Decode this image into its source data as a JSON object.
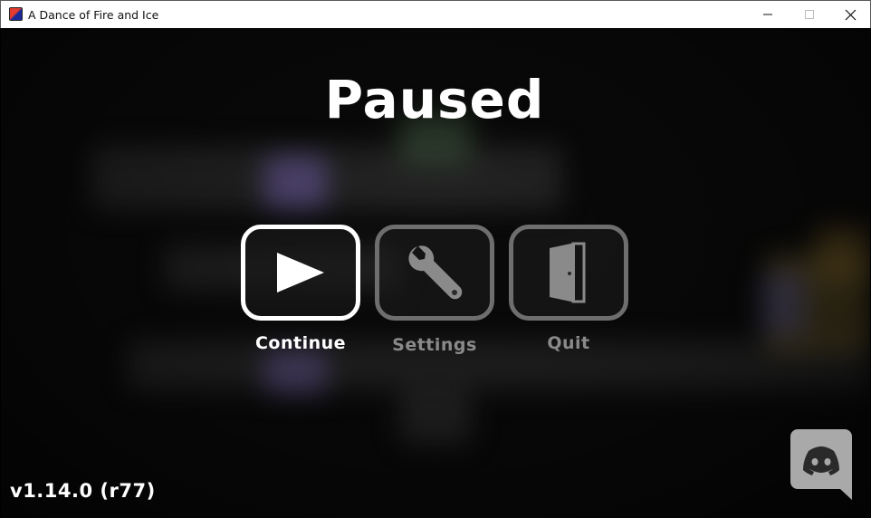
{
  "window": {
    "title": "A Dance of Fire and Ice",
    "icon": "adofai-app-icon",
    "controls": [
      "minimize-icon",
      "maximize-icon",
      "close-icon"
    ]
  },
  "pause_menu": {
    "title": "Paused",
    "buttons": [
      {
        "label": "Continue",
        "icon": "play-icon",
        "selected": true
      },
      {
        "label": "Settings",
        "icon": "wrench-icon",
        "selected": false
      },
      {
        "label": "Quit",
        "icon": "door-icon",
        "selected": false
      }
    ]
  },
  "version": "v1.14.0 (r77)",
  "discord": {
    "icon": "discord-icon"
  },
  "colors": {
    "selected": "#ffffff",
    "unselected": "#6e6e6e",
    "background": "#0a0a0a"
  }
}
